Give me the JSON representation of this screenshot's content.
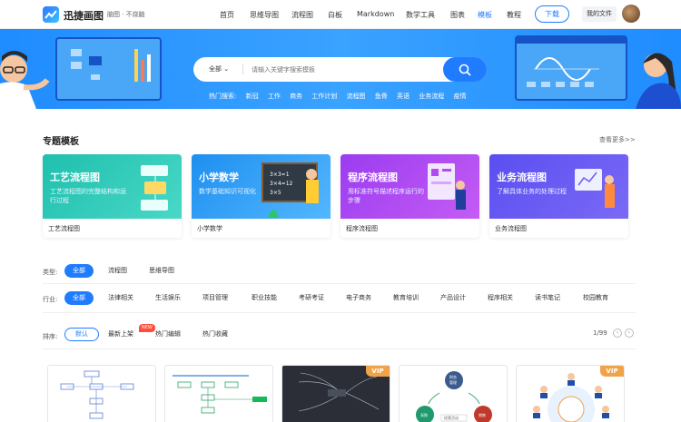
{
  "header": {
    "brand": "迅捷画图",
    "subtitle": "脑图 · 不烧脑",
    "nav": [
      "首页",
      "思维导图",
      "流程图",
      "白板",
      "Markdown",
      "数学工具",
      "图表",
      "模板",
      "教程"
    ],
    "active_nav": "模板",
    "download_label": "下载",
    "myfiles_label": "我的文件"
  },
  "banner": {
    "search_select": "全部",
    "search_placeholder": "请输入关键字搜索模板",
    "hot_label": "热门搜索:",
    "hot_terms": [
      "新冠",
      "工作",
      "商务",
      "工作计划",
      "流程图",
      "鱼骨",
      "英语",
      "业务流程",
      "疫情"
    ]
  },
  "topics": {
    "title": "专题模板",
    "see_more": "查看更多>>",
    "cards": [
      {
        "title": "工艺流程图",
        "desc": "工艺流程图的完整结构和运行过程",
        "caption": "工艺流程图",
        "color": "#25c6b5"
      },
      {
        "title": "小学数学",
        "desc": "数学基础知识可视化",
        "caption": "小学数学",
        "color": "#2fa3ef"
      },
      {
        "title": "程序流程图",
        "desc": "用标准符号描述程序运行的步骤",
        "caption": "程序流程图",
        "color": "#b04cf2"
      },
      {
        "title": "业务流程图",
        "desc": "了解具体业务的处理过程",
        "caption": "业务流程图",
        "color": "#6b5cf0"
      }
    ]
  },
  "filters": {
    "type_label": "类型:",
    "types": [
      "全部",
      "流程图",
      "思维导图"
    ],
    "industry_label": "行业:",
    "industries": [
      "全部",
      "法律相关",
      "生活娱乐",
      "项目管理",
      "职业技能",
      "考研考证",
      "电子商务",
      "教育培训",
      "产品设计",
      "程序相关",
      "读书笔记",
      "校园教育"
    ],
    "sort_label": "排序:",
    "sorts": [
      "默认",
      "最新上架",
      "热门编辑",
      "热门收藏"
    ],
    "new_badge": "NEW",
    "page": "1/99"
  },
  "thumbs": {
    "vip_label": "VIP",
    "mind_labels": [
      "财务",
      "管理",
      "采购",
      "销售",
      "经营活动"
    ]
  },
  "colors": {
    "accent": "#1f7cff",
    "vip": "#f1a34a"
  }
}
